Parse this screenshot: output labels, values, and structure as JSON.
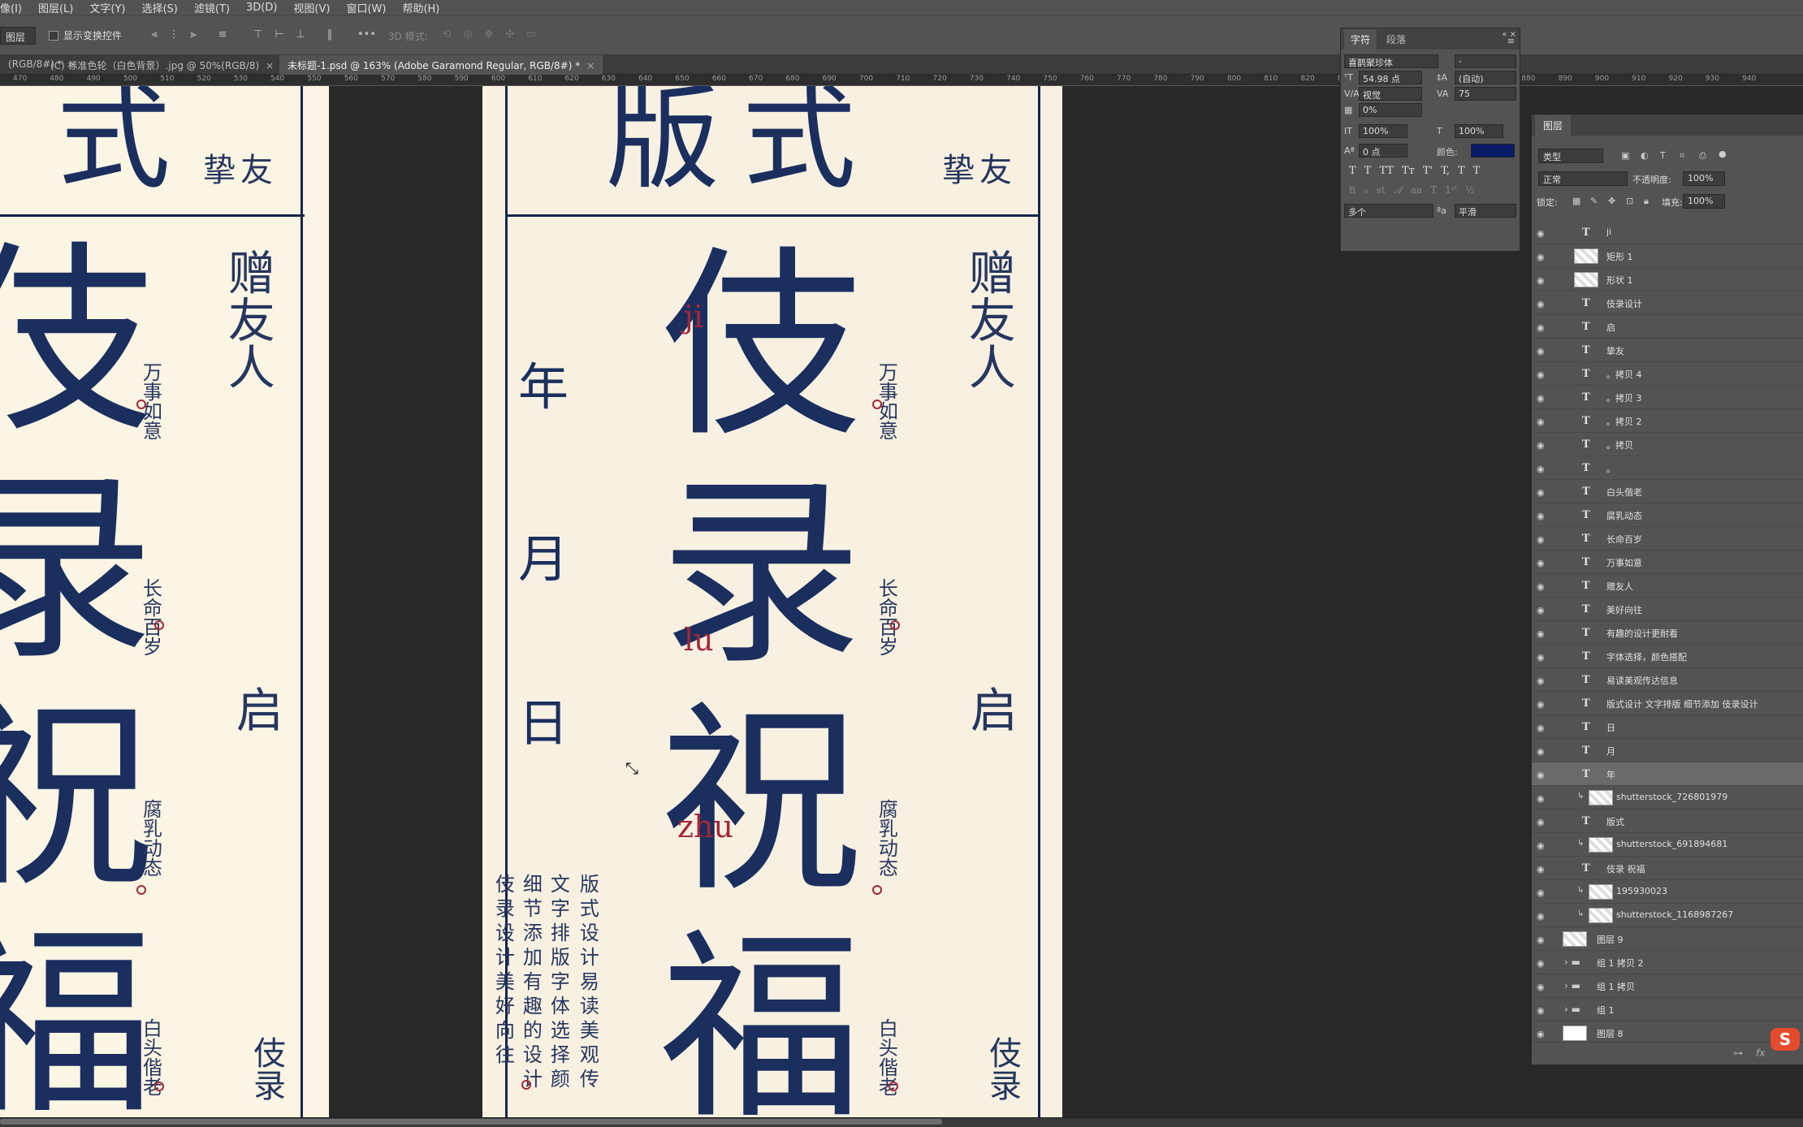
{
  "menubar": [
    "图层(L)",
    "文字(Y)",
    "选择(S)",
    "滤镜(T)",
    "3D(D)",
    "视图(V)",
    "窗口(W)",
    "帮助(H)"
  ],
  "menubar_left": "像(I)",
  "options": {
    "tool_select": "图层",
    "show_transform": "显示变换控件",
    "mode3d": "3D 模式:"
  },
  "tabs": [
    {
      "label": "(RGB/8#) *"
    },
    {
      "label": "(C) 标准色轮（白色背景）.jpg @ 50%(RGB/8)"
    },
    {
      "label": "未标题-1.psd @ 163% (Adobe Garamond Regular, RGB/8#) *"
    }
  ],
  "ruler": [
    "470",
    "480",
    "490",
    "500",
    "510",
    "520",
    "530",
    "540",
    "550",
    "560",
    "570",
    "580",
    "590",
    "600",
    "610",
    "620",
    "630",
    "640",
    "650",
    "660",
    "670",
    "680",
    "690",
    "700",
    "710",
    "720",
    "730",
    "740",
    "750",
    "760",
    "770",
    "780",
    "790",
    "800",
    "810",
    "820",
    "830",
    "840",
    "850",
    "860",
    "870",
    "880",
    "890",
    "900",
    "910",
    "920",
    "930",
    "940"
  ],
  "artboard_left": {
    "title_chars": "式",
    "title_small": "挚友",
    "main_chars": [
      "伎",
      "录",
      "祝",
      "福"
    ],
    "col_zengyouren": "赠友人",
    "col_qi": "启",
    "col_jilu": "伎录",
    "small_1": "万事如意",
    "small_2": "长命百岁",
    "small_3": "腐乳动态",
    "small_4": "白头偕老"
  },
  "artboard_main": {
    "title": "版式",
    "title_small": "挚友",
    "main_chars": [
      "伎",
      "录",
      "祝",
      "福"
    ],
    "pinyin": [
      "ji",
      "lu",
      "zhu"
    ],
    "year": "年",
    "month": "月",
    "day": "日",
    "col_zengyouren": "赠友人",
    "col_qi": "启",
    "col_jilu": "伎录",
    "small_1": "万事如意",
    "small_2": "长命百岁",
    "small_3": "腐乳动态",
    "small_4": "白头偕老",
    "poem_cols": [
      "版式设计易读美观传",
      "文字排版字体选择颜",
      "细节添加有趣的设计",
      "伎录设计美好向往"
    ]
  },
  "character_panel": {
    "tab_char": "字符",
    "tab_para": "段落",
    "font_family": "喜鹊聚珍体",
    "font_style": "-",
    "font_size": "54.98 点",
    "leading": "(自动)",
    "kerning": "视觉",
    "tracking": "75",
    "scale_pct": "0%",
    "vscale": "100%",
    "hscale": "100%",
    "baseline": "0 点",
    "color_label": "颜色:",
    "color": "#0b1a66",
    "lang": "多个",
    "aa": "平滑",
    "style_buttons": [
      "T",
      "T",
      "TT",
      "Tт",
      "T'",
      "T,",
      "T",
      "T"
    ]
  },
  "layers_panel": {
    "tab": "图层",
    "filter": "类型",
    "blend": "正常",
    "opacity_label": "不透明度:",
    "opacity": "100%",
    "lock_label": "锁定:",
    "fill_label": "填充:",
    "fill": "100%",
    "layers": [
      {
        "name": "ji",
        "kind": "text"
      },
      {
        "name": "矩形 1",
        "kind": "shape"
      },
      {
        "name": "形状 1",
        "kind": "shape"
      },
      {
        "name": "伎录设计",
        "kind": "text"
      },
      {
        "name": "启",
        "kind": "text"
      },
      {
        "name": "挚友",
        "kind": "text"
      },
      {
        "name": "。拷贝 4",
        "kind": "text"
      },
      {
        "name": "。拷贝 3",
        "kind": "text"
      },
      {
        "name": "。拷贝 2",
        "kind": "text"
      },
      {
        "name": "。拷贝",
        "kind": "text"
      },
      {
        "name": "。",
        "kind": "text"
      },
      {
        "name": "白头偕老",
        "kind": "text"
      },
      {
        "name": "腐乳动态",
        "kind": "text"
      },
      {
        "name": "长命百岁",
        "kind": "text"
      },
      {
        "name": "万事如意",
        "kind": "text"
      },
      {
        "name": "赠友人",
        "kind": "text"
      },
      {
        "name": "美好向往",
        "kind": "text"
      },
      {
        "name": "有趣的设计更耐看",
        "kind": "text"
      },
      {
        "name": "字体选择，颜色搭配",
        "kind": "text"
      },
      {
        "name": "易读美观传达信息",
        "kind": "text"
      },
      {
        "name": "版式设计 文字排版 细节添加 伎录设计",
        "kind": "text"
      },
      {
        "name": "日",
        "kind": "text"
      },
      {
        "name": "月",
        "kind": "text"
      },
      {
        "name": "年",
        "kind": "text",
        "selected": true
      },
      {
        "name": "shutterstock_726801979",
        "kind": "clip"
      },
      {
        "name": "版式",
        "kind": "text"
      },
      {
        "name": "shutterstock_691894681",
        "kind": "clip"
      },
      {
        "name": "伎录 祝福",
        "kind": "text"
      },
      {
        "name": "195930023",
        "kind": "clip"
      },
      {
        "name": "shutterstock_1168987267",
        "kind": "clip"
      },
      {
        "name": "图层 9",
        "kind": "raster"
      },
      {
        "name": "组 1 拷贝 2",
        "kind": "group"
      },
      {
        "name": "组 1 拷贝",
        "kind": "group"
      },
      {
        "name": "组 1",
        "kind": "group"
      },
      {
        "name": "图层 8",
        "kind": "white"
      }
    ]
  }
}
